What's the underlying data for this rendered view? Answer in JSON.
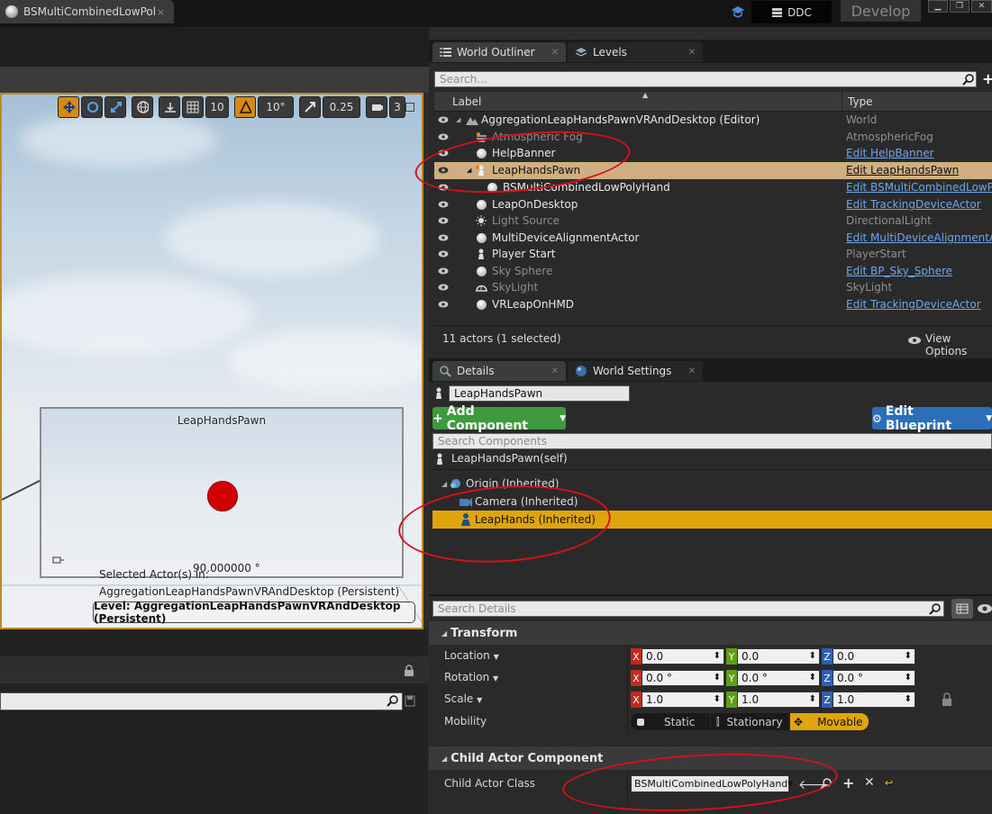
{
  "title_bar": {
    "doc_tab_label": "BSMultiCombinedLowPol",
    "doc_tab_close": "×",
    "ddc_label": "DDC",
    "develop_label": "Develop"
  },
  "viewport": {
    "toolbar": {
      "grid_snap": "10",
      "rotation_snap": "10°",
      "scale_snap": "0.25",
      "camera_speed": "3"
    },
    "preview": {
      "title": "LeapHandsPawn",
      "angle": "90.000000 °"
    },
    "selected_line1": "Selected Actor(s) in:",
    "selected_line2": "AggregationLeapHandsPawnVRAndDesktop (Persistent)",
    "level_label": "Level:  AggregationLeapHandsPawnVRAndDesktop (Persistent)"
  },
  "outliner": {
    "tabs": [
      {
        "label": "World Outliner"
      },
      {
        "label": "Levels"
      }
    ],
    "search_placeholder": "Search...",
    "col_label": "Label",
    "col_type": "Type",
    "rows": [
      {
        "label": "AggregationLeapHandsPawnVRAndDesktop (Editor)",
        "type": "World"
      },
      {
        "label": "Atmospheric Fog",
        "type": "AtmosphericFog"
      },
      {
        "label": "HelpBanner",
        "type": "Edit HelpBanner"
      },
      {
        "label": "LeapHandsPawn",
        "type": "Edit LeapHandsPawn"
      },
      {
        "label": "BSMultiCombinedLowPolyHand",
        "type": "Edit BSMultiCombinedLowPo"
      },
      {
        "label": "LeapOnDesktop",
        "type": "Edit TrackingDeviceActor"
      },
      {
        "label": "Light Source",
        "type": "DirectionalLight"
      },
      {
        "label": "MultiDeviceAlignmentActor",
        "type": "Edit MultiDeviceAlignmentAct"
      },
      {
        "label": "Player Start",
        "type": "PlayerStart"
      },
      {
        "label": "Sky Sphere",
        "type": "Edit BP_Sky_Sphere"
      },
      {
        "label": "SkyLight",
        "type": "SkyLight"
      },
      {
        "label": "VRLeapOnHMD",
        "type": "Edit TrackingDeviceActor"
      }
    ],
    "actor_count": "11 actors (1 selected)",
    "view_options": "View Options"
  },
  "details": {
    "tabs": [
      {
        "label": "Details"
      },
      {
        "label": "World Settings"
      }
    ],
    "actor_name": "LeapHandsPawn",
    "add_component": "Add Component",
    "edit_blueprint": "Edit Blueprint",
    "search_components_placeholder": "Search Components",
    "self_label": "LeapHandsPawn(self)",
    "components": [
      {
        "label": "Origin (Inherited)"
      },
      {
        "label": "Camera (Inherited)"
      },
      {
        "label": "LeapHands (Inherited)"
      }
    ],
    "search_details_placeholder": "Search Details",
    "transform": {
      "header": "Transform",
      "location_label": "Location",
      "rotation_label": "Rotation",
      "scale_label": "Scale",
      "mobility_label": "Mobility",
      "location": {
        "x": "0.0",
        "y": "0.0",
        "z": "0.0"
      },
      "rotation": {
        "x": "0.0 °",
        "y": "0.0 °",
        "z": "0.0 °"
      },
      "scale": {
        "x": "1.0",
        "y": "1.0",
        "z": "1.0"
      },
      "mobility_options": [
        "Static",
        "Stationary",
        "Movable"
      ],
      "mobility_selected": "Movable"
    },
    "child_actor": {
      "header": "Child Actor Component",
      "class_label": "Child Actor Class",
      "class_value": "BSMultiCombinedLowPolyHand"
    }
  },
  "colors": {
    "selection_orange": "#e0a50c",
    "viewport_border": "#c08a20",
    "annotation_red": "#d8101a",
    "link_blue": "#6ea6ea"
  }
}
